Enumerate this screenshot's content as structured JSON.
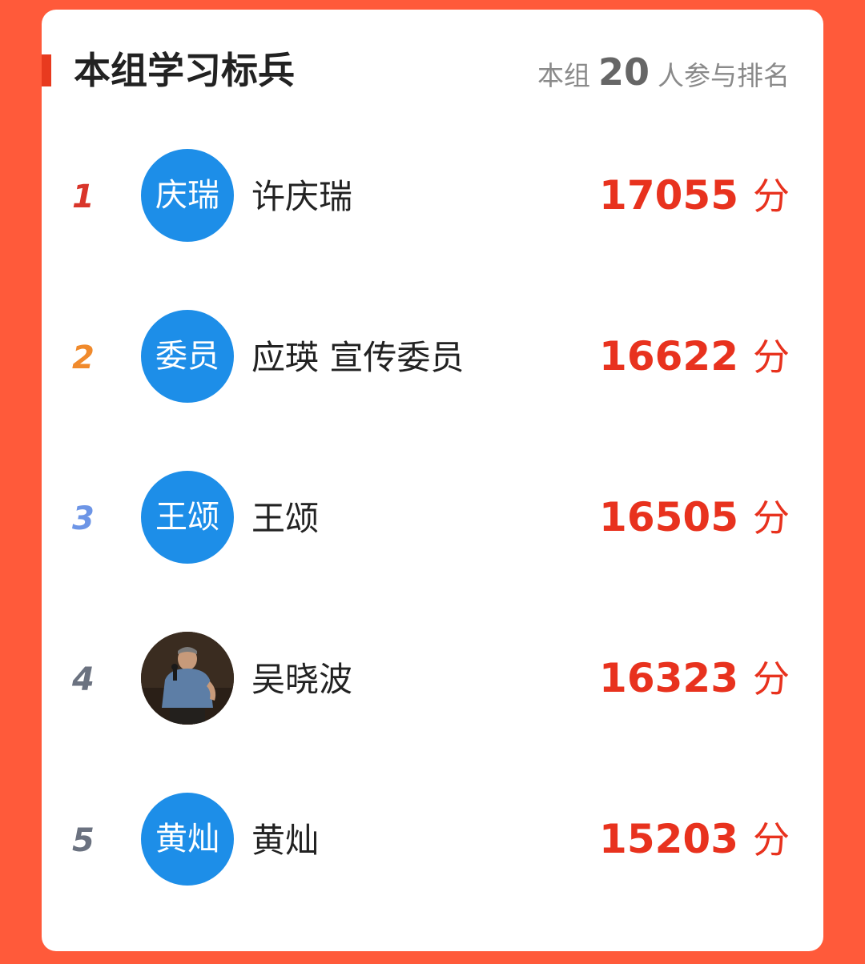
{
  "header": {
    "title": "本组学习标兵",
    "meta_prefix": "本组",
    "meta_count": "20",
    "meta_suffix": "人参与排名"
  },
  "colors": {
    "background": "#ff5a3a",
    "accent": "#e83a1f",
    "avatar_blue": "#1d8ee8",
    "score_red": "#e8321e"
  },
  "ranking": [
    {
      "rank": "1",
      "rank_color": "#d9352a",
      "avatar_text": "庆瑞",
      "name": "许庆瑞",
      "score": "17055",
      "unit": "分"
    },
    {
      "rank": "2",
      "rank_color": "#f08a2c",
      "avatar_text": "委员",
      "name": "应瑛 宣传委员",
      "score": "16622",
      "unit": "分"
    },
    {
      "rank": "3",
      "rank_color": "#6d95e6",
      "avatar_text": "王颂",
      "name": "王颂",
      "score": "16505",
      "unit": "分"
    },
    {
      "rank": "4",
      "rank_color": "#6b7280",
      "avatar_text": "",
      "avatar_photo": true,
      "name": "吴晓波",
      "score": "16323",
      "unit": "分"
    },
    {
      "rank": "5",
      "rank_color": "#6b7280",
      "avatar_text": "黄灿",
      "name": "黄灿",
      "score": "15203",
      "unit": "分"
    }
  ]
}
